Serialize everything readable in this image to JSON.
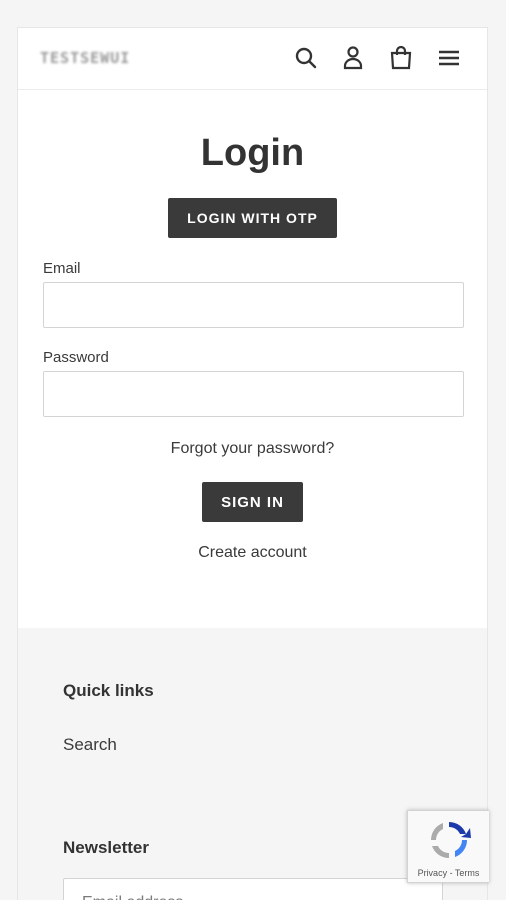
{
  "header": {
    "logo_text": "TESTSEWUI",
    "icons": [
      "search-icon",
      "account-icon",
      "cart-icon",
      "menu-icon"
    ]
  },
  "login": {
    "title": "Login",
    "otp_button": "LOGIN WITH OTP",
    "email_label": "Email",
    "email_value": "",
    "password_label": "Password",
    "password_value": "",
    "forgot_link": "Forgot your password?",
    "signin_button": "SIGN IN",
    "create_account_link": "Create account"
  },
  "footer": {
    "quick_links_heading": "Quick links",
    "quick_links": [
      "Search"
    ],
    "newsletter_heading": "Newsletter",
    "newsletter_placeholder": "Email address"
  },
  "recaptcha": {
    "privacy": "Privacy",
    "separator": " - ",
    "terms": "Terms"
  },
  "colors": {
    "button_bg": "#3a3a3a",
    "text": "#3a3a3a",
    "footer_bg": "#f5f5f5"
  }
}
